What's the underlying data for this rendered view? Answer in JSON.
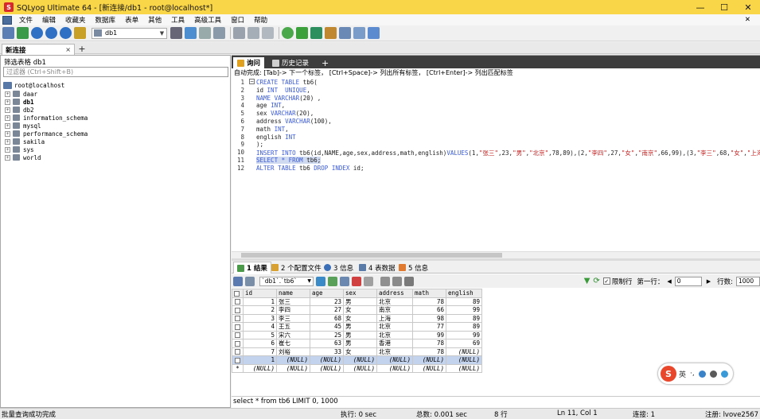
{
  "window": {
    "title": "SQLyog Ultimate 64 - [新连接/db1 - root@localhost*]",
    "minimize": "—",
    "maximize": "☐",
    "close": "✕"
  },
  "menu": {
    "items": [
      "文件",
      "编辑",
      "收藏夹",
      "数据库",
      "表单",
      "其他",
      "工具",
      "高级工具",
      "窗口",
      "帮助"
    ],
    "right_close": "✕"
  },
  "toolbar": {
    "db_selected": "db1"
  },
  "connection_tabs": {
    "active_label": "新连接",
    "close": "×",
    "add": "+"
  },
  "object_browser": {
    "filter_label": "筛选表格 db1",
    "filter_placeholder": "过滤器 (Ctrl+Shift+B)",
    "server": "root@localhost",
    "databases": [
      "daar",
      "db1",
      "db2",
      "information_schema",
      "mysql",
      "performance_schema",
      "sakila",
      "sys",
      "world"
    ],
    "active_db": "db1"
  },
  "query_tabs": {
    "tab1": "询问",
    "tab2": "历史记录",
    "add": "+"
  },
  "hint": "自动完成: [Tab]-> 下一个标签， [Ctrl+Space]-> 列出所有标签， [Ctrl+Enter]-> 列出匹配标签",
  "editor": {
    "lines": [
      {
        "n": "1",
        "parts": [
          {
            "t": "CREATE TABLE",
            "c": "kw"
          },
          {
            "t": " tb6(",
            "c": ""
          }
        ]
      },
      {
        "n": "2",
        "parts": [
          {
            "t": "id ",
            "c": ""
          },
          {
            "t": "INT",
            "c": "kw"
          },
          {
            "t": "  ",
            "c": ""
          },
          {
            "t": "UNIQUE",
            "c": "kw"
          },
          {
            "t": ",",
            "c": ""
          }
        ]
      },
      {
        "n": "3",
        "parts": [
          {
            "t": "NAME",
            "c": "kw"
          },
          {
            "t": " ",
            "c": ""
          },
          {
            "t": "VARCHAR",
            "c": "kw"
          },
          {
            "t": "(20) ,",
            "c": ""
          }
        ]
      },
      {
        "n": "4",
        "parts": [
          {
            "t": "age ",
            "c": ""
          },
          {
            "t": "INT",
            "c": "kw"
          },
          {
            "t": ",",
            "c": ""
          }
        ]
      },
      {
        "n": "5",
        "parts": [
          {
            "t": "sex ",
            "c": ""
          },
          {
            "t": "VARCHAR",
            "c": "kw"
          },
          {
            "t": "(20),",
            "c": ""
          }
        ]
      },
      {
        "n": "6",
        "parts": [
          {
            "t": "address ",
            "c": ""
          },
          {
            "t": "VARCHAR",
            "c": "kw"
          },
          {
            "t": "(100),",
            "c": ""
          }
        ]
      },
      {
        "n": "7",
        "parts": [
          {
            "t": "math ",
            "c": ""
          },
          {
            "t": "INT",
            "c": "kw"
          },
          {
            "t": ",",
            "c": ""
          }
        ]
      },
      {
        "n": "8",
        "parts": [
          {
            "t": "english ",
            "c": ""
          },
          {
            "t": "INT",
            "c": "kw"
          }
        ]
      },
      {
        "n": "9",
        "parts": [
          {
            "t": ");",
            "c": ""
          }
        ]
      },
      {
        "n": "10",
        "parts": [
          {
            "t": "INSERT INTO",
            "c": "kw"
          },
          {
            "t": " tb6(id,NAME,age,sex,address,math,english)",
            "c": ""
          },
          {
            "t": "VALUES",
            "c": "kw"
          },
          {
            "t": "(1,",
            "c": ""
          },
          {
            "t": "\"张三\"",
            "c": "str"
          },
          {
            "t": ",23,",
            "c": ""
          },
          {
            "t": "\"男\"",
            "c": "str"
          },
          {
            "t": ",",
            "c": ""
          },
          {
            "t": "\"北京\"",
            "c": "str"
          },
          {
            "t": ",78,89),(2,",
            "c": ""
          },
          {
            "t": "\"李四\"",
            "c": "str"
          },
          {
            "t": ",27,",
            "c": ""
          },
          {
            "t": "\"女\"",
            "c": "str"
          },
          {
            "t": ",",
            "c": ""
          },
          {
            "t": "\"南京\"",
            "c": "str"
          },
          {
            "t": ",66,99),(3,",
            "c": ""
          },
          {
            "t": "\"李三\"",
            "c": "str"
          },
          {
            "t": ",68,",
            "c": ""
          },
          {
            "t": "\"女\"",
            "c": "str"
          },
          {
            "t": ",",
            "c": ""
          },
          {
            "t": "\"上海\"",
            "c": "str"
          }
        ]
      },
      {
        "n": "11",
        "parts": [
          {
            "t": "SELECT * FROM",
            "c": "kw hl"
          },
          {
            "t": " tb6;",
            "c": "hl"
          }
        ]
      },
      {
        "n": "12",
        "parts": [
          {
            "t": "ALTER TABLE",
            "c": "kw"
          },
          {
            "t": " tb6 ",
            "c": ""
          },
          {
            "t": "DROP INDEX",
            "c": "kw"
          },
          {
            "t": " id;",
            "c": ""
          }
        ]
      }
    ]
  },
  "result_tabs": {
    "t1": "1 结果",
    "t2": "2 个配置文件",
    "t3": "3 信息",
    "t4": "4 表数据",
    "t5": "5 信息"
  },
  "result_toolbar": {
    "table_select": "`db1`.`tb6`",
    "limit_label": "限制行",
    "first_row_label": "第一行：",
    "first_row_value": "0",
    "rows_label": "行数:",
    "rows_value": "1000"
  },
  "grid": {
    "columns": [
      "id",
      "name",
      "age",
      "sex",
      "address",
      "math",
      "english"
    ],
    "rows": [
      [
        "1",
        "张三",
        "23",
        "男",
        "北京",
        "78",
        "89"
      ],
      [
        "2",
        "李四",
        "27",
        "女",
        "南京",
        "66",
        "99"
      ],
      [
        "3",
        "李三",
        "68",
        "女",
        "上海",
        "98",
        "89"
      ],
      [
        "4",
        "王五",
        "45",
        "男",
        "北京",
        "77",
        "89"
      ],
      [
        "5",
        "宋六",
        "25",
        "男",
        "北京",
        "99",
        "99"
      ],
      [
        "6",
        "崔七",
        "63",
        "男",
        "香港",
        "78",
        "69"
      ],
      [
        "7",
        "刘裕",
        "33",
        "女",
        "北京",
        "78",
        "(NULL)"
      ]
    ],
    "selected_row": [
      "1",
      "(NULL)",
      "(NULL)",
      "(NULL)",
      "(NULL)",
      "(NULL)",
      "(NULL)"
    ],
    "new_row": [
      "(NULL)",
      "(NULL)",
      "(NULL)",
      "(NULL)",
      "(NULL)",
      "(NULL)",
      "(NULL)"
    ],
    "new_row_marker": "*"
  },
  "sql_status": "select * from tb6 LIMIT 0, 1000",
  "status_bar": {
    "left": "批量查询成功完成",
    "exec": "执行: 0 sec",
    "total": "总数: 0.001 sec",
    "rows": "8 行",
    "ln": "Ln 11, Col 1",
    "conn": "连接: 1",
    "reg": "注册: lvove2567"
  },
  "ime": {
    "logo": "S",
    "lang": "英",
    "punct": "·,"
  },
  "colors": {
    "titlebar": "#f9d548",
    "keyword": "#3a5ad8",
    "string": "#c21d1d",
    "selection": "#c3d3ee"
  }
}
